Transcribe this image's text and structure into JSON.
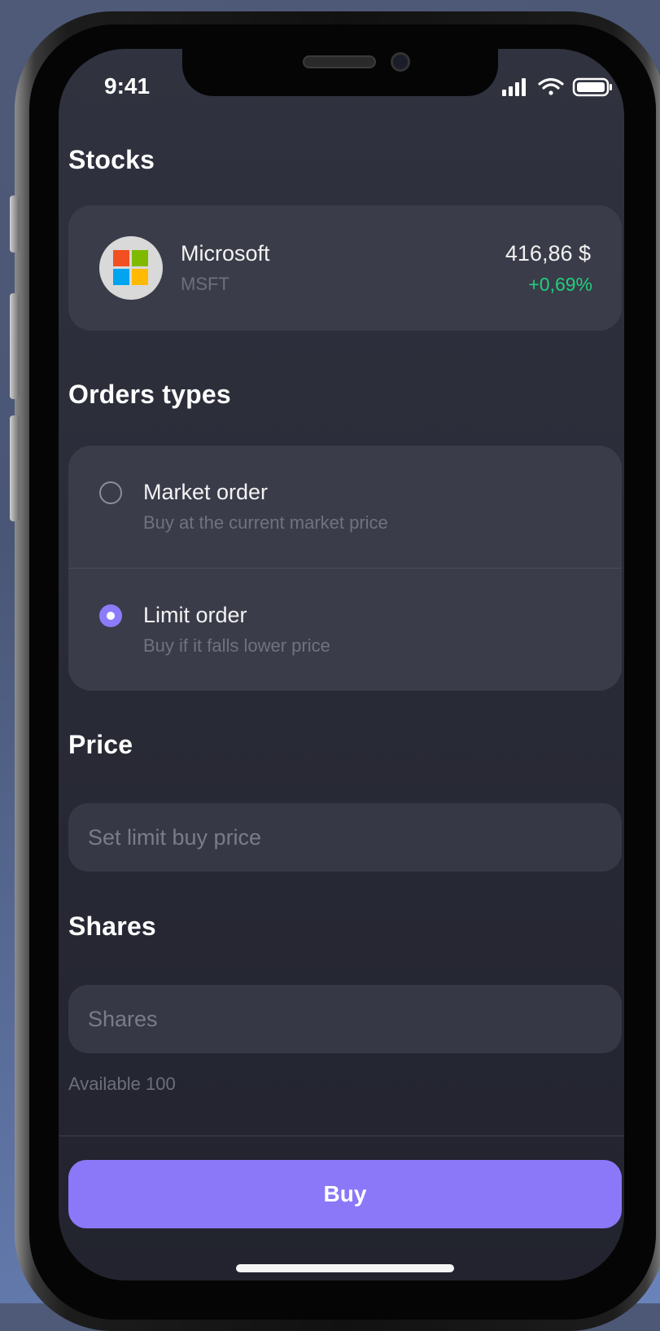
{
  "status_bar": {
    "time": "9:41",
    "icons": [
      "signal-icon",
      "wifi-icon",
      "battery-icon"
    ]
  },
  "stocks_section": {
    "title": "Stocks",
    "stock": {
      "name": "Microsoft",
      "ticker": "MSFT",
      "price": "416,86 $",
      "change": "+0,69%",
      "change_color": "#21d07d",
      "logo_icon": "microsoft-logo-icon"
    }
  },
  "orders_section": {
    "title": "Orders types",
    "options": [
      {
        "label": "Market order",
        "description": "Buy at the current market price",
        "selected": false
      },
      {
        "label": "Limit order",
        "description": "Buy if it falls lower price",
        "selected": true
      }
    ]
  },
  "price_section": {
    "title": "Price",
    "placeholder": "Set limit buy price",
    "value": ""
  },
  "shares_section": {
    "title": "Shares",
    "placeholder": "Shares",
    "value": "",
    "available": "Available 100"
  },
  "buy_button": {
    "label": "Buy"
  },
  "colors": {
    "accent": "#8a78f8",
    "positive": "#21d07d",
    "background": "#2a2c38",
    "card": "#3a3c49"
  }
}
